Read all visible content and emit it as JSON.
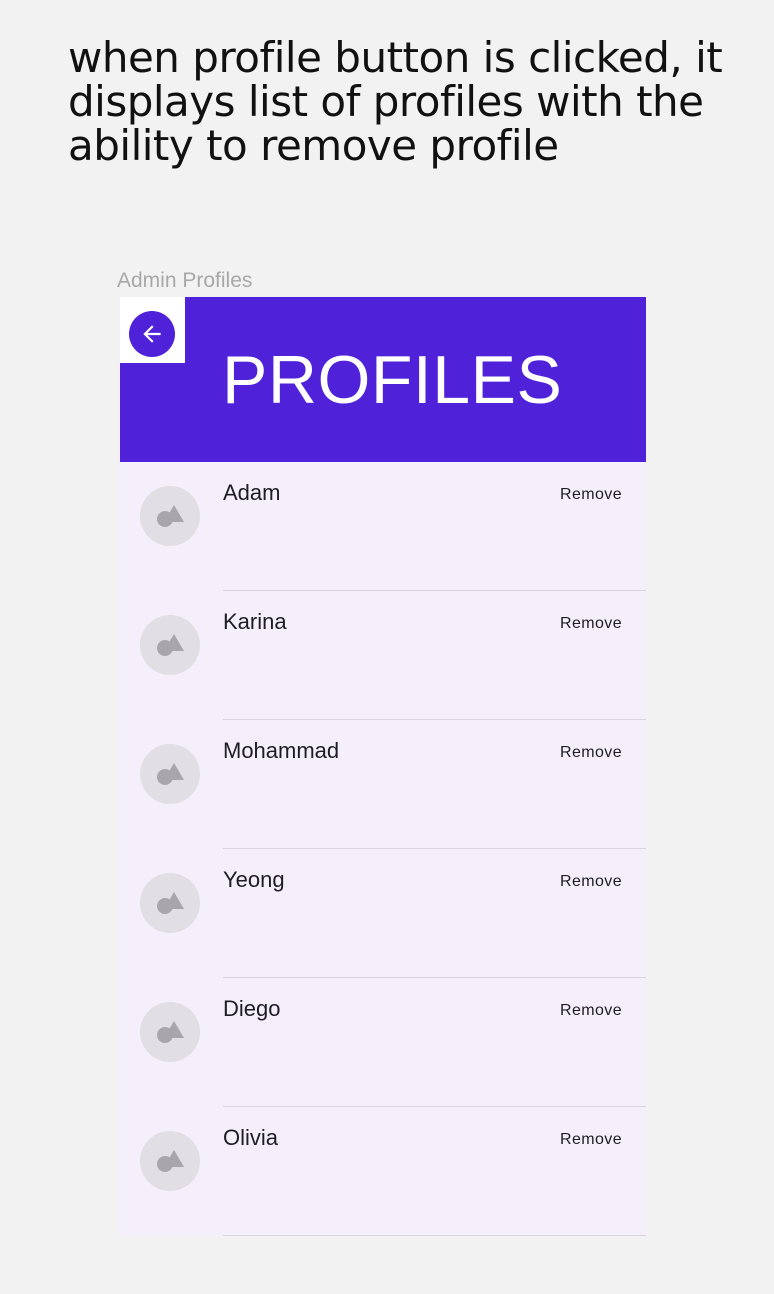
{
  "caption": "when profile button is clicked, it displays list of profiles with the ability to remove profile",
  "frame_label": "Admin Profiles",
  "header": {
    "title": "PROFILES",
    "back_icon": "arrow-left-icon"
  },
  "profiles": [
    {
      "name": "Adam",
      "action": "Remove"
    },
    {
      "name": "Karina",
      "action": "Remove"
    },
    {
      "name": "Mohammad",
      "action": "Remove"
    },
    {
      "name": "Yeong",
      "action": "Remove"
    },
    {
      "name": "Diego",
      "action": "Remove"
    },
    {
      "name": "Olivia",
      "action": "Remove"
    }
  ],
  "colors": {
    "accent": "#4f22da",
    "list_background": "#f4effb",
    "avatar_background": "#e2dfe4",
    "page_background": "#f2f2f2"
  }
}
